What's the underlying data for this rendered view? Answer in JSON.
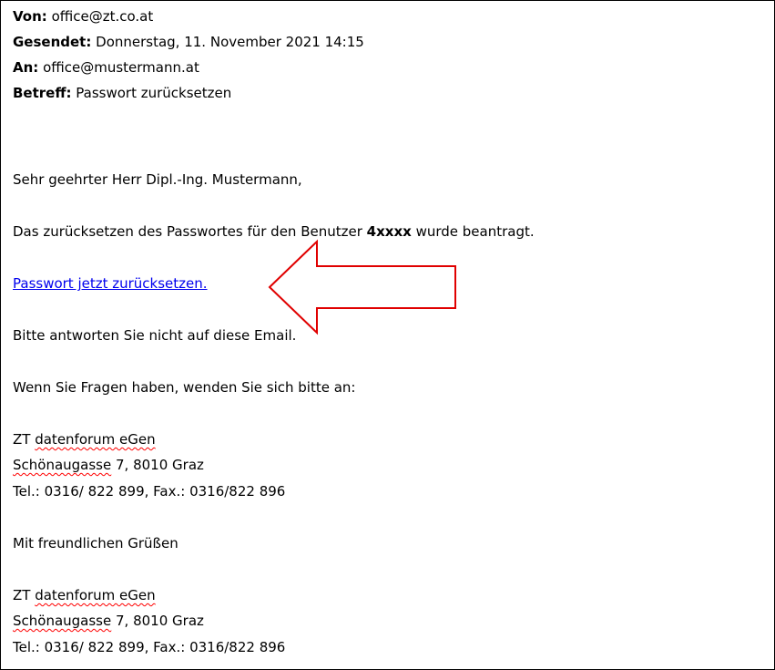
{
  "header": {
    "from_label": "Von:",
    "from_value": "office@zt.co.at",
    "sent_label": "Gesendet:",
    "sent_value": "Donnerstag, 11. November 2021 14:15",
    "to_label": "An:",
    "to_value": "office@mustermann.at",
    "subject_label": "Betreff:",
    "subject_value": "Passwort zurücksetzen"
  },
  "body": {
    "greeting": "Sehr geehrter Herr Dipl.-Ing. Mustermann,",
    "reset_text_before": "Das zurücksetzen des Passwortes für den Benutzer ",
    "reset_user": "4xxxx",
    "reset_text_after": " wurde beantragt.",
    "reset_link": "Passwort jetzt zurücksetzen.",
    "no_reply": "Bitte antworten Sie nicht auf diese Email.",
    "questions": "Wenn Sie Fragen haben, wenden Sie sich bitte an:",
    "contact": {
      "org_prefix": "ZT ",
      "org_name": "datenforum eGen",
      "street": "Schönaugasse",
      "address_rest": " 7, 8010 Graz",
      "phone": "Tel.: 0316/ 822 899, Fax.: 0316/822 896"
    },
    "closing": "Mit freundlichen Grüßen",
    "signature": {
      "org_prefix": "ZT ",
      "org_name": "datenforum eGen",
      "street": "Schönaugasse",
      "address_rest": " 7, 8010 Graz",
      "phone": "Tel.: 0316/ 822 899, Fax.: 0316/822 896"
    }
  },
  "colors": {
    "link": "#0000ee",
    "annotation_arrow": "#e00000",
    "spellcheck": "#ff0000"
  }
}
